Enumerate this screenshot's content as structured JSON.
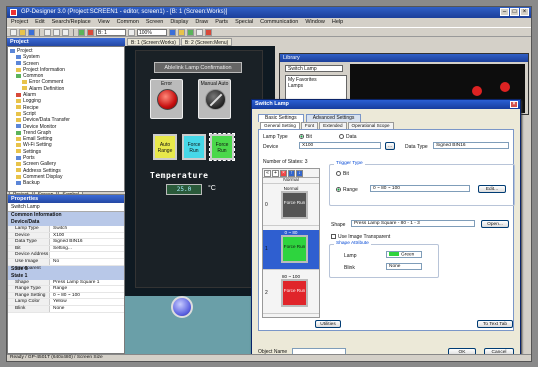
{
  "window": {
    "title": "GP-Designer 3.0 (Project:SCREEN1 - editor, screen1) - [B: 1 (Screen:Works)]"
  },
  "menu": [
    "Project",
    "Edit",
    "Search/Replace",
    "View",
    "Common",
    "Screen",
    "Display",
    "Draw",
    "Parts",
    "Special",
    "Communication",
    "Window",
    "Help"
  ],
  "toolbar": {
    "zoom": "100%",
    "screen_combo": "B: 1"
  },
  "project_pane": {
    "title": "Project",
    "tree": [
      {
        "label": "Project",
        "depth": 0,
        "icon": "b"
      },
      {
        "label": "System",
        "depth": 1,
        "icon": "b"
      },
      {
        "label": "Screen",
        "depth": 1,
        "icon": "b"
      },
      {
        "label": "Project Information",
        "depth": 1,
        "icon": "y"
      },
      {
        "label": "Common",
        "depth": 1,
        "icon": "g"
      },
      {
        "label": "Error Comment",
        "depth": 2,
        "icon": "y"
      },
      {
        "label": "Alarm Definition",
        "depth": 2,
        "icon": "y"
      },
      {
        "label": "Alarm",
        "depth": 1,
        "icon": "r"
      },
      {
        "label": "Logging",
        "depth": 1,
        "icon": "y"
      },
      {
        "label": "Recipe",
        "depth": 1,
        "icon": "y"
      },
      {
        "label": "Script",
        "depth": 1,
        "icon": "y"
      },
      {
        "label": "Device/Data Transfer",
        "depth": 1,
        "icon": "y"
      },
      {
        "label": "Device Monitor",
        "depth": 1,
        "icon": "b"
      },
      {
        "label": "Trend Graph",
        "depth": 1,
        "icon": "g"
      },
      {
        "label": "Email Setting",
        "depth": 1,
        "icon": "y"
      },
      {
        "label": "Wi-Fi Setting",
        "depth": 1,
        "icon": "y"
      },
      {
        "label": "Settings",
        "depth": 1,
        "icon": "y"
      },
      {
        "label": "Ports",
        "depth": 1,
        "icon": "b"
      },
      {
        "label": "Screen Gallery",
        "depth": 1,
        "icon": "y"
      },
      {
        "label": "Address Settings",
        "depth": 1,
        "icon": "y"
      },
      {
        "label": "Comment Display",
        "depth": 1,
        "icon": "y"
      },
      {
        "label": "Backup",
        "depth": 1,
        "icon": "b"
      }
    ],
    "tabs": [
      "Project",
      "Screen",
      "Symbol"
    ]
  },
  "properties_pane": {
    "title": "Properties",
    "selected": "Switch Lamp",
    "sections": [
      {
        "category": "Common Information",
        "rows": []
      },
      {
        "category": "Device/Data",
        "rows": [
          {
            "k": "Lamp Type",
            "v": "Switch"
          },
          {
            "k": "Device",
            "v": "X100"
          },
          {
            "k": "Data Type",
            "v": "Signed BIN16"
          },
          {
            "k": "Bit",
            "v": "Setting..."
          },
          {
            "k": "Device Address",
            "v": ""
          },
          {
            "k": "Use Image Transparent",
            "v": "No"
          }
        ]
      },
      {
        "category": "State 0",
        "rows": []
      },
      {
        "category": "State 1",
        "rows": [
          {
            "k": "Shape",
            "v": "Press Lamp Square 1"
          },
          {
            "k": "Range Type",
            "v": "Range"
          },
          {
            "k": "Range Setting",
            "v": "0 ~ 80 ~ 100"
          },
          {
            "k": "Lamp Color",
            "v": "Yellow"
          },
          {
            "k": "Blink",
            "v": "None"
          }
        ]
      }
    ]
  },
  "editor": {
    "tabs": [
      "B: 1 (Screen:Works)",
      "B: 2 (Screen:Menu)"
    ],
    "banner": "Ablelink Lamp Confirmation",
    "lamp_left": "Error",
    "lamp_right": "Manual Auto",
    "switches": [
      "Auto Range",
      "Force Run",
      "Force Run"
    ],
    "temperature_label": "Temperature",
    "temperature_value": "25.0",
    "temperature_unit": "°C"
  },
  "library": {
    "title": "Library",
    "combo": "Switch Lamp",
    "list": [
      "My Favorites",
      "Lamps"
    ]
  },
  "dialog": {
    "title": "Switch Lamp",
    "tabs": [
      "Basic Settings",
      "Advanced Settings"
    ],
    "subtabs": [
      "General Setting",
      "Font",
      "Extended",
      "Operational Scope"
    ],
    "lamp_type_label": "Lamp Type",
    "lamp_type_options": [
      "Bit",
      "Data"
    ],
    "device_label": "Device",
    "device_value": "X100",
    "data_type_label": "Data Type",
    "data_type_value": "Signed BIN16",
    "states_label": "Number of States",
    "states_count": "3",
    "states_header": "Normal",
    "states": [
      {
        "num": "0",
        "label": "Normal",
        "color": "#555555",
        "text": "Force Run"
      },
      {
        "num": "1",
        "label": "0 ~ 80",
        "color": "#2ed43e",
        "text": "Force Run"
      },
      {
        "num": "2",
        "label": "80 ~ 100",
        "color": "#e0252a",
        "text": "Force Run"
      }
    ],
    "trigger_title": "Trigger Type",
    "trigger_bit": "Bit",
    "trigger_range": "Range",
    "range_value": "0 ~ 80 ~ 100",
    "edit_button": "Edit...",
    "shape_label": "Shape",
    "shape_value": "Press Lamp Square - 80 - 1 - 3",
    "open_button": "Open...",
    "use_transparent": "Use Image Transparent",
    "shape_attr_title": "Shape Attribute",
    "lamp_label": "Lamp",
    "lamp_color_value": "Green",
    "blink_label": "Blink",
    "blink_value": "None",
    "utilities_button": "Utilities",
    "to_text_tab_button": "To Text Tab",
    "object_name_label": "Object Name",
    "object_name_value": "",
    "ok_button": "OK",
    "cancel_button": "Cancel"
  },
  "status": "Ready / GP-4501T (640x480) / Screen Size"
}
